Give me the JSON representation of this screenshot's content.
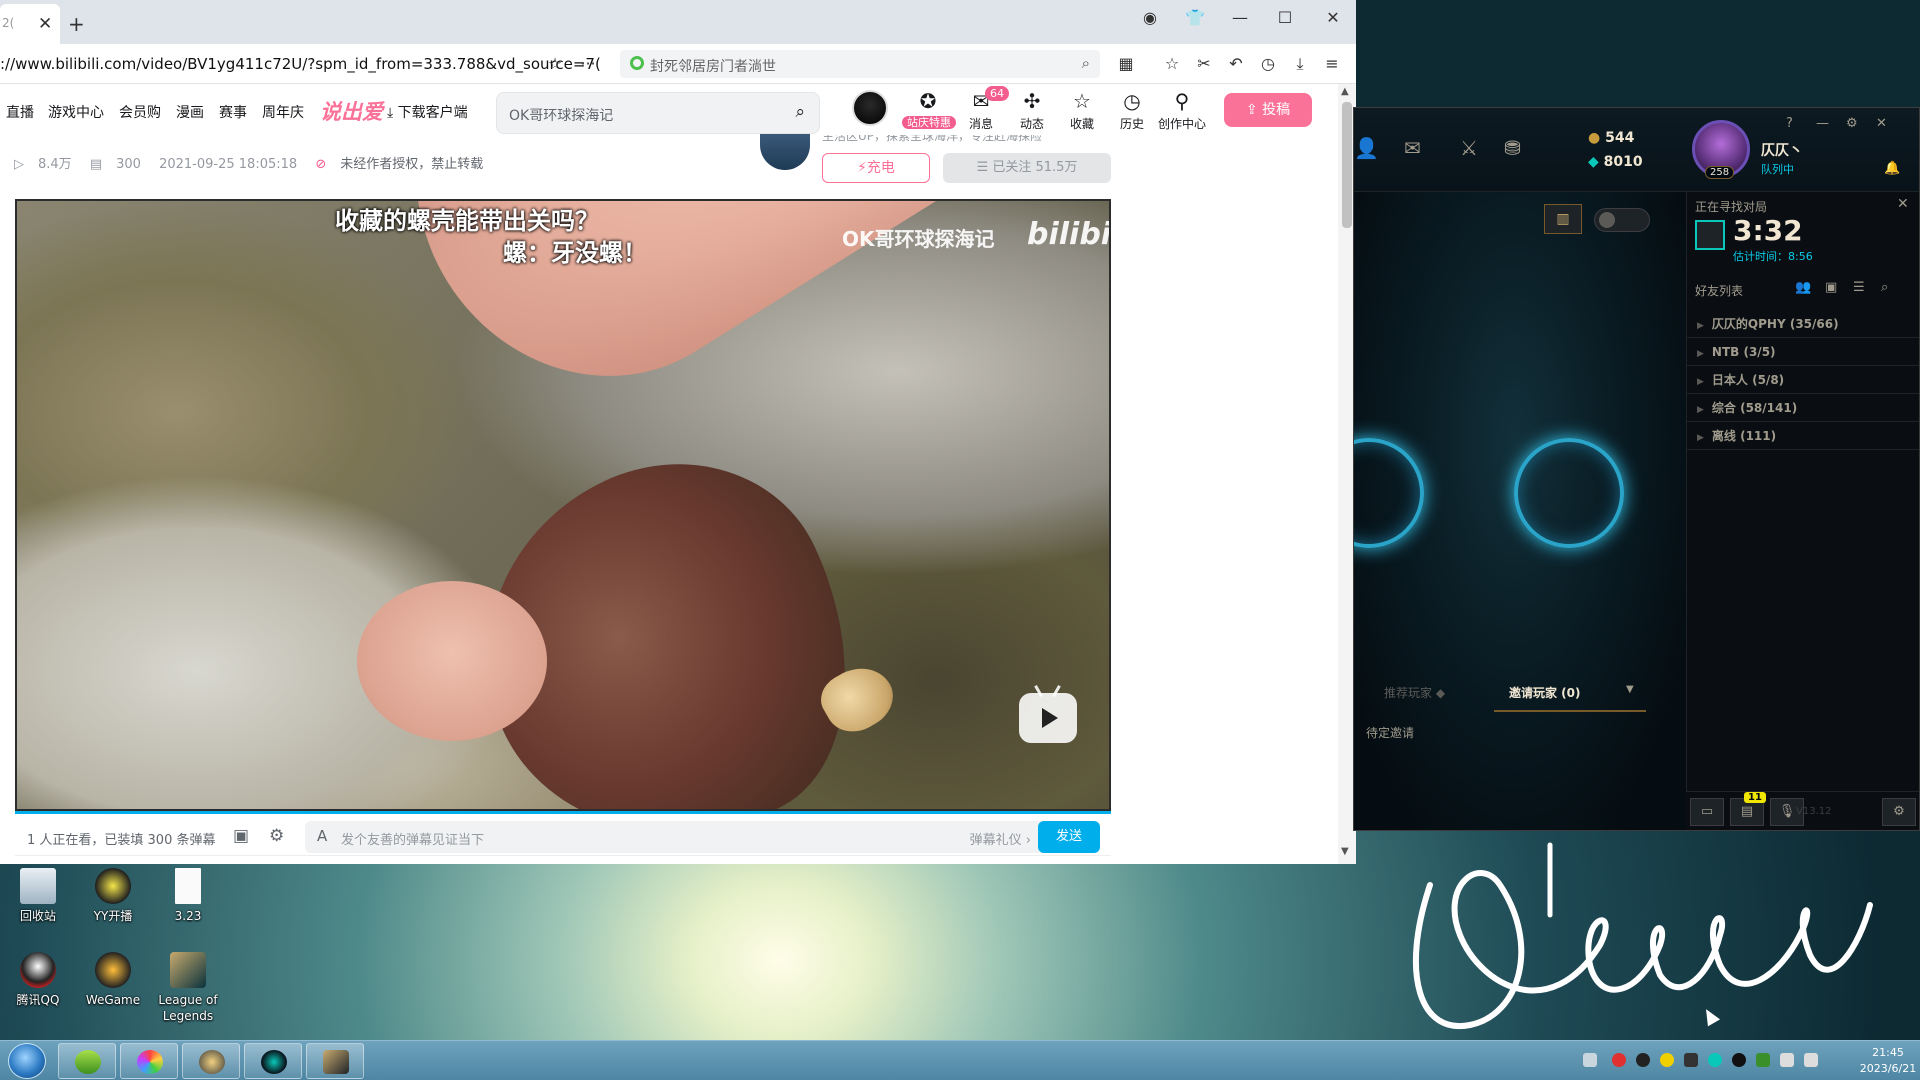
{
  "browser": {
    "tab_title": "2(",
    "url": "://www.bilibili.com/video/BV1yg411c72U/?spm_id_from=333.788&vd_source=7(",
    "search_engine_query": "封死邻居房门者淌世"
  },
  "bili_nav": {
    "links": [
      "直播",
      "游戏中心",
      "会员购",
      "漫画",
      "赛事",
      "周年庆"
    ],
    "promo": "说出爱",
    "download": "下载客户端",
    "search_value": "OK哥环球探海记",
    "header_icons": [
      {
        "label": "站庆特惠",
        "icon": "gift-icon"
      },
      {
        "label": "消息",
        "icon": "message-icon",
        "badge": "64"
      },
      {
        "label": "动态",
        "icon": "dynamic-icon"
      },
      {
        "label": "收藏",
        "icon": "star-icon"
      },
      {
        "label": "历史",
        "icon": "history-icon"
      },
      {
        "label": "创作中心",
        "icon": "bulb-icon"
      }
    ],
    "upload": "投稿"
  },
  "video": {
    "views": "8.4万",
    "danmaku": "300",
    "date": "2021-09-25 18:05:18",
    "copyright": "未经作者授权，禁止转载",
    "charge": "充电",
    "follow": "已关注 51.5万",
    "up_desc": "生活区UP，探索全球海洋，专注赶海探险",
    "subtitle1": "收藏的螺壳能带出关吗？",
    "subtitle2": "螺：牙没螺！",
    "watermark": "OK哥环球探海记",
    "watermark_logo": "bilibili",
    "accent": "#00aeec"
  },
  "danmaku_bar": {
    "count": "1 人正在看，已装填 300 条弹幕",
    "placeholder": "发个友善的弹幕见证当下",
    "etiquette": "弹幕礼仪 ›",
    "send": "发送"
  },
  "lol": {
    "be": "544",
    "rp": "8010",
    "level": "258",
    "name": "仄仄丶",
    "status": "队列中",
    "searching": "正在寻找对局",
    "timer": "3:32",
    "est": "估计时间：8:56",
    "friends_title": "好友列表",
    "groups": [
      "仄仄的QPHY (35/66)",
      "NTB (3/5)",
      "日本人 (5/8)",
      "综合 (58/141)",
      "离线 (111)"
    ],
    "tab_recommend": "推荐玩家",
    "tab_invite": "邀请玩家 (0)",
    "pending": "待定邀请",
    "notify_badge": "11",
    "version": "V13.12"
  },
  "desktop": {
    "icons": [
      {
        "label": "回收站",
        "icon": "recycle-bin-icon"
      },
      {
        "label": "YY开播",
        "icon": "yy-icon"
      },
      {
        "label": "3.23",
        "icon": "document-icon"
      },
      {
        "label": "腾讯QQ",
        "icon": "qq-icon"
      },
      {
        "label": "WeGame",
        "icon": "wegame-icon"
      },
      {
        "label": "League of Legends",
        "icon": "lol-icon"
      }
    ]
  },
  "taskbar": {
    "time": "21:45",
    "date": "2023/6/21"
  }
}
